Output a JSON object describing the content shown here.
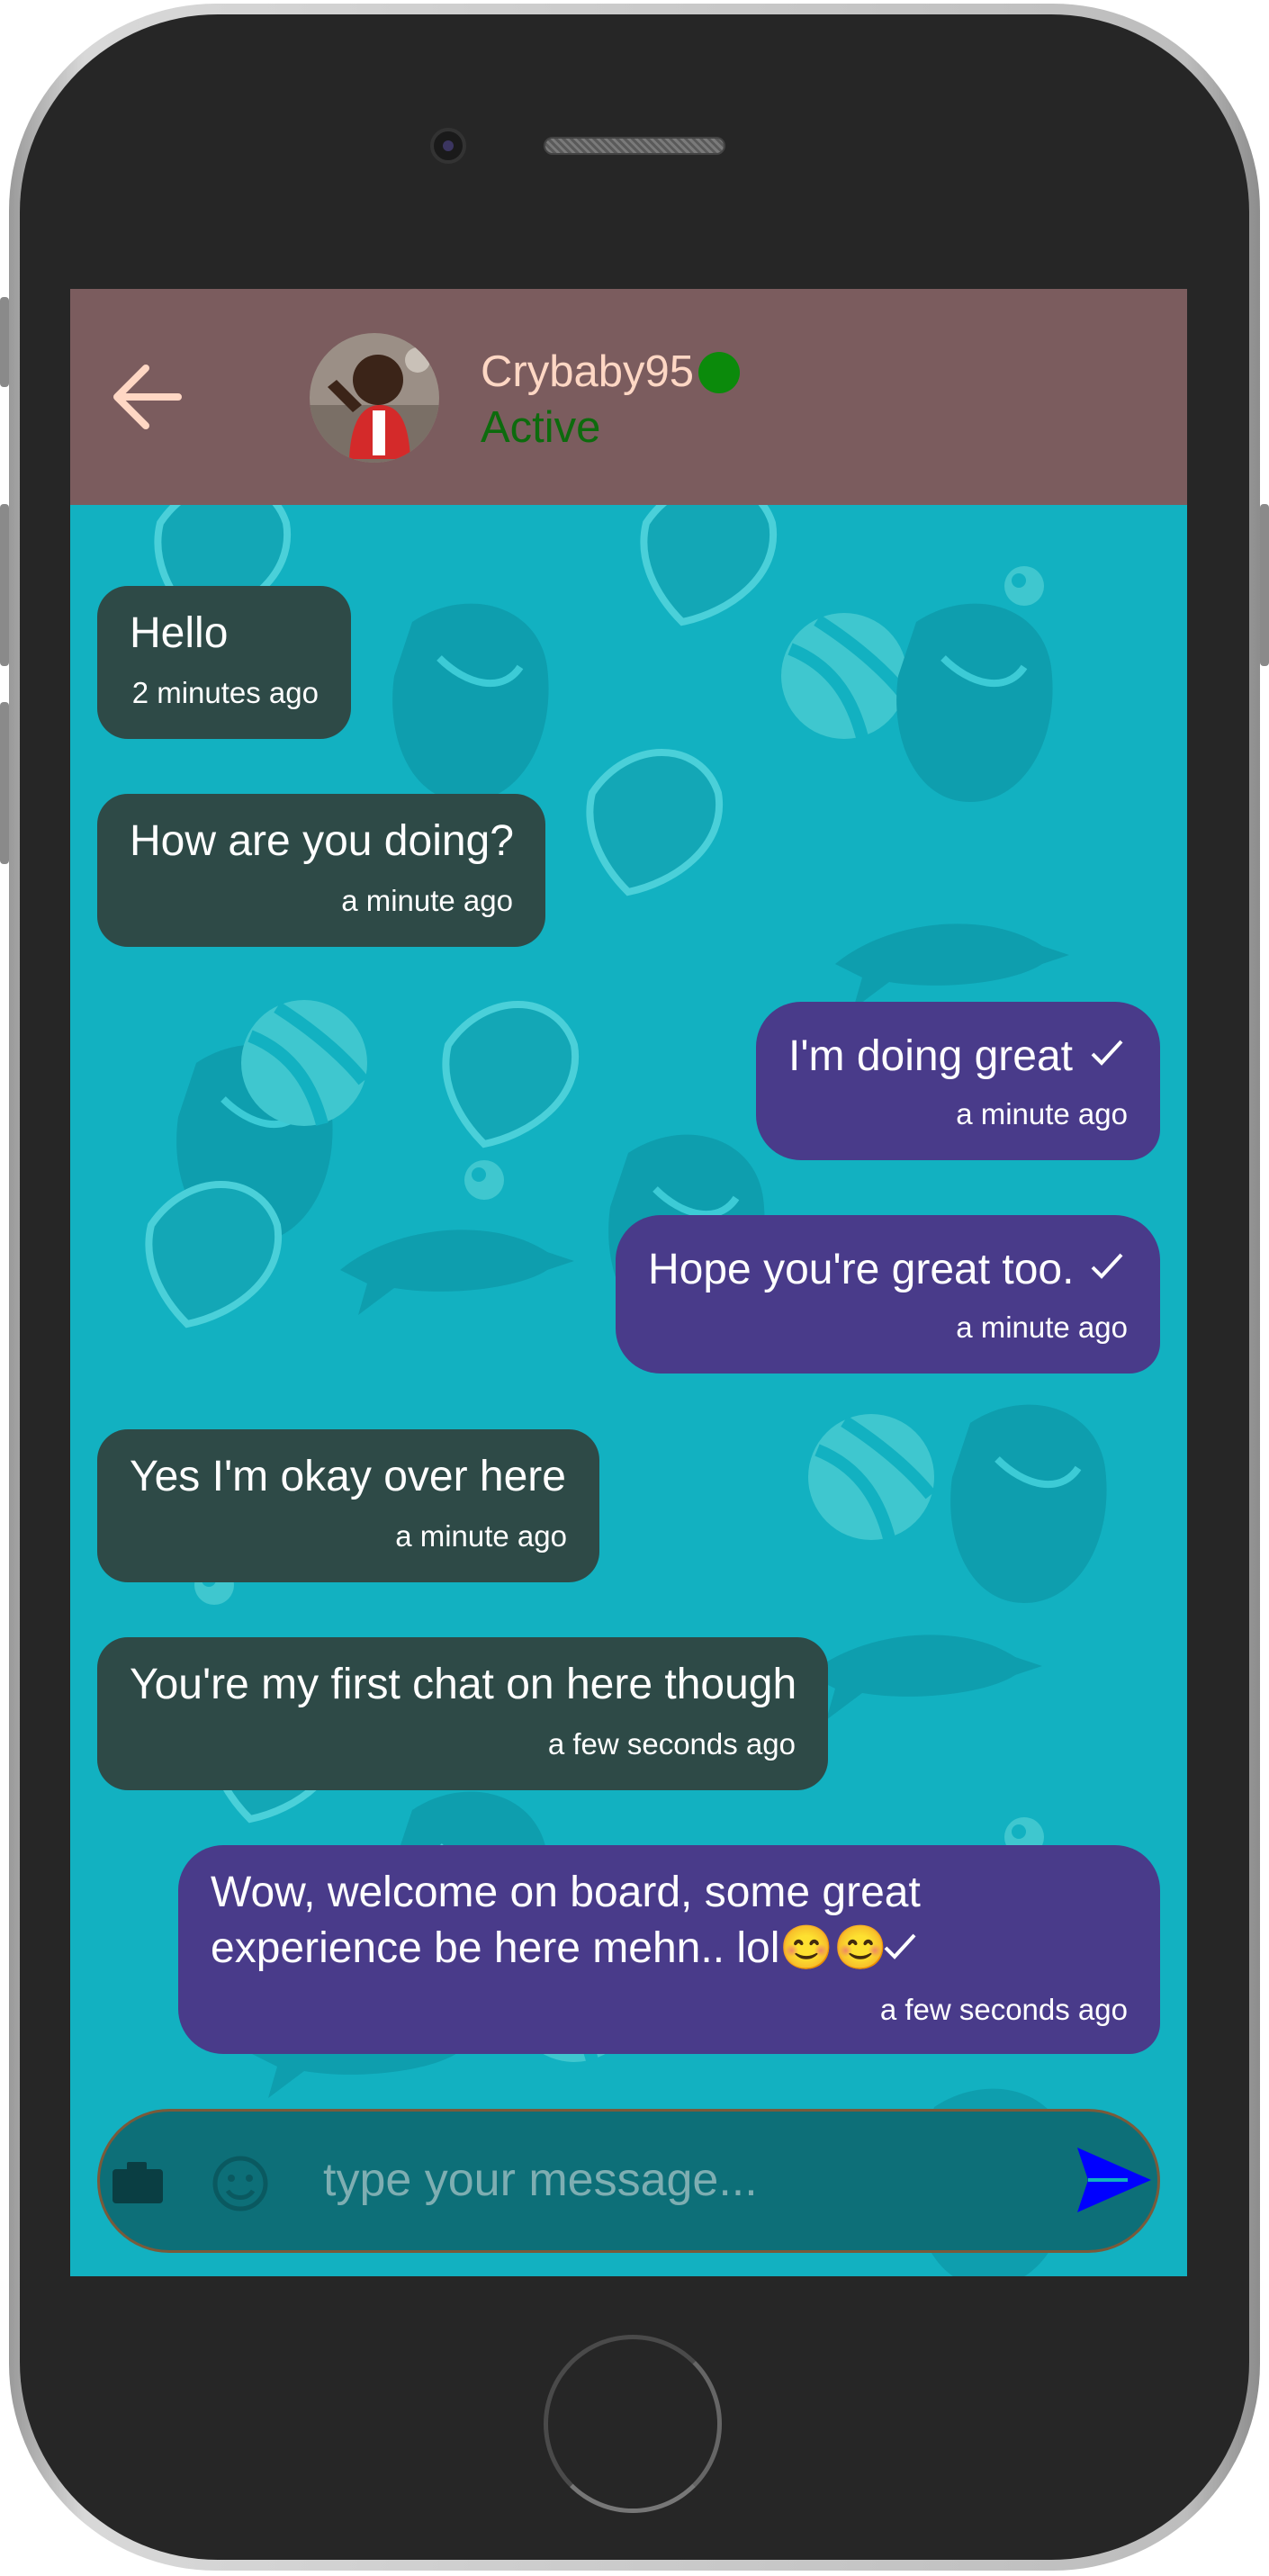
{
  "header": {
    "back_icon": "arrow-left-icon",
    "contact_name": "Crybaby95",
    "online_color": "#0b8a0b",
    "status": "Active",
    "header_color": "#7b5c5e"
  },
  "messages": [
    {
      "direction": "incoming",
      "text": "Hello",
      "time": "2 minutes ago"
    },
    {
      "direction": "incoming",
      "text": "How are you doing?",
      "time": "a minute ago"
    },
    {
      "direction": "outgoing",
      "text": "I'm doing great",
      "time": "a minute ago",
      "status_icon": "check-icon"
    },
    {
      "direction": "outgoing",
      "text": "Hope you're great too.",
      "time": "a minute ago",
      "status_icon": "check-icon"
    },
    {
      "direction": "incoming",
      "text": "Yes I'm okay over here",
      "time": "a minute ago"
    },
    {
      "direction": "incoming",
      "text": "You're my first chat on here though",
      "time": "a few seconds ago"
    },
    {
      "direction": "outgoing",
      "text_line1": "Wow, welcome on board, some great",
      "text_line2": "experience be here mehn.. lol😊😊",
      "time": "a few seconds ago",
      "status_icon": "check-icon"
    }
  ],
  "composer": {
    "camera_icon": "camera-icon",
    "emoji_icon": "emoji-icon",
    "placeholder": "type your message...",
    "send_icon": "send-icon",
    "send_color": "#0000ff"
  },
  "colors": {
    "incoming_bubble": "#2e4a47",
    "outgoing_bubble": "#493b8a",
    "chat_background": "#12b1c1"
  }
}
